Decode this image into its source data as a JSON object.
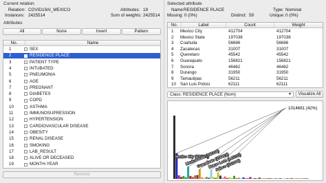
{
  "current_relation": {
    "title": "Current relation",
    "relation_label": "Relation:",
    "relation_value": "COVID19AI_MEXICO",
    "instances_label": "Instances:",
    "instances_value": "2425514",
    "attributes_label": "Attributes:",
    "attributes_value": "19",
    "sum_weights_label": "Sum of weights:",
    "sum_weights_value": "2425514"
  },
  "attributes_panel": {
    "title": "Attributes",
    "buttons": {
      "all": "All",
      "none": "None",
      "invert": "Invert",
      "pattern": "Pattern"
    },
    "columns": {
      "no": "No.",
      "name": "Name"
    },
    "rows": [
      {
        "no": "1",
        "name": "SEX"
      },
      {
        "no": "2",
        "name": "RESIDENCE PLACE"
      },
      {
        "no": "3",
        "name": "PATIENT TYPE"
      },
      {
        "no": "4",
        "name": "INTUBATED"
      },
      {
        "no": "5",
        "name": "PNEUMONIA"
      },
      {
        "no": "6",
        "name": "AGE"
      },
      {
        "no": "7",
        "name": "PREGNANT"
      },
      {
        "no": "8",
        "name": "DIABETES"
      },
      {
        "no": "9",
        "name": "COPD"
      },
      {
        "no": "10",
        "name": "ASTHMA"
      },
      {
        "no": "11",
        "name": "IMMUNOSUPRESSION"
      },
      {
        "no": "12",
        "name": "HYPERTENSION"
      },
      {
        "no": "13",
        "name": "CARDIOVASCULAR DISEASE"
      },
      {
        "no": "14",
        "name": "OBESITY"
      },
      {
        "no": "15",
        "name": "RENAL DISEASE"
      },
      {
        "no": "16",
        "name": "SMOKING"
      },
      {
        "no": "17",
        "name": "LAB_RESULT"
      },
      {
        "no": "18",
        "name": "ALIVE OR DECEASED"
      },
      {
        "no": "19",
        "name": "MONTH-YEAR"
      }
    ],
    "selected_index": 1,
    "remove_button": "Remove"
  },
  "selected_attribute": {
    "title": "Selected attribute",
    "name_label": "Name:",
    "name_value": "RESIDENCE PLACE",
    "type_label": "Type:",
    "type_value": "Nominal",
    "missing_label": "Missing:",
    "missing_value": "0 (0%)",
    "distinct_label": "Distinct:",
    "distinct_value": "59",
    "unique_label": "Unique:",
    "unique_value": "0 (0%)",
    "columns": {
      "no": "No.",
      "label": "Label",
      "count": "Count",
      "weight": "Weight"
    },
    "rows": [
      {
        "no": "1",
        "label": "Mexico City",
        "count": "412704",
        "weight": "412704"
      },
      {
        "no": "2",
        "label": "Mexico State",
        "count": "197038",
        "weight": "197038"
      },
      {
        "no": "3",
        "label": "Coahuila",
        "count": "56686",
        "weight": "56686"
      },
      {
        "no": "4",
        "label": "Zacatecas",
        "count": "31007",
        "weight": "31007"
      },
      {
        "no": "5",
        "label": "Queretaro",
        "count": "45542",
        "weight": "45542"
      },
      {
        "no": "6",
        "label": "Guanajuato",
        "count": "156821",
        "weight": "156821"
      },
      {
        "no": "7",
        "label": "Sonora",
        "count": "46462",
        "weight": "46462"
      },
      {
        "no": "8",
        "label": "Durango",
        "count": "31950",
        "weight": "31950"
      },
      {
        "no": "9",
        "label": "Tamaulipas",
        "count": "56211",
        "weight": "56211"
      },
      {
        "no": "10",
        "label": "San Luis Potosi",
        "count": "62111",
        "weight": "62111"
      }
    ]
  },
  "class_bar": {
    "select_value": "Class: RESIDENCE PLACE (Nom)",
    "visualize_button": "Visualize All"
  },
  "chart_data": {
    "type": "bar",
    "ymax": 1014681,
    "max_label": "1014681 (42%)",
    "annotations": [
      {
        "text": "Mexico City (412704)",
        "bar": 1
      },
      {
        "text": "Mexico State (197038)",
        "bar": 6
      },
      {
        "text": "Guanajuato (156821)",
        "bar": 11
      },
      {
        "text": "Nuevo Leon (145212)",
        "bar": 16
      },
      {
        "text": "Jalisco (102006)",
        "bar": 19
      }
    ],
    "values": [
      1014681,
      412704,
      56686,
      31007,
      45542,
      26000,
      197038,
      46462,
      31950,
      56211,
      62111,
      156821,
      24000,
      20000,
      30000,
      18000,
      145212,
      28000,
      16000,
      102006,
      52000,
      22000,
      38000,
      14000,
      26000,
      12000,
      48000,
      10000,
      18000,
      9000,
      24000,
      8000,
      14000,
      30000,
      7000,
      12000,
      6000,
      20000,
      5500,
      9000,
      5000,
      11000,
      4500,
      8000,
      4000,
      7000,
      3500,
      6000,
      3000,
      5000,
      2800,
      4500,
      2500,
      4000,
      2000,
      3000,
      1800,
      2200,
      1500
    ],
    "colors": [
      "#2a2a2a",
      "#2323b8",
      "#8a1fb0",
      "#b41c1c",
      "#24a324",
      "#24a324",
      "#23a3a3",
      "#b41c1c",
      "#d05a1c",
      "#7a7a7a",
      "#b41c1c",
      "#c49a16",
      "#d46ac9",
      "#d8d800",
      "#7a7a7a",
      "#b41c1c",
      "#7fd6d6",
      "#a6c61c",
      "#2e6e2e",
      "#c9c218",
      "#3a3a3a",
      "#b6a0d6",
      "#e06060",
      "#8a2a2a",
      "#c9c218",
      "#e08a1c",
      "#24a324",
      "#5a3aa6",
      "#d05a1c",
      "#7fd6d6",
      "#2323b8",
      "#b41c1c",
      "#6b8e23",
      "#8a1fb0",
      "#c49a16",
      "#3a3a3a",
      "#24a324",
      "#8a2a2a",
      "#d46ac9",
      "#23a3a3",
      "#7a7a7a",
      "#2e6e2e",
      "#b41c1c",
      "#c9c218",
      "#5a3aa6",
      "#e08a1c",
      "#2323b8",
      "#7fd6d6",
      "#a6c61c",
      "#8a1fb0",
      "#d05a1c",
      "#2a2a2a",
      "#b6a0d6",
      "#24a324",
      "#c49a16",
      "#e06060",
      "#6b8e23",
      "#8a2a2a",
      "#23a3a3"
    ]
  }
}
